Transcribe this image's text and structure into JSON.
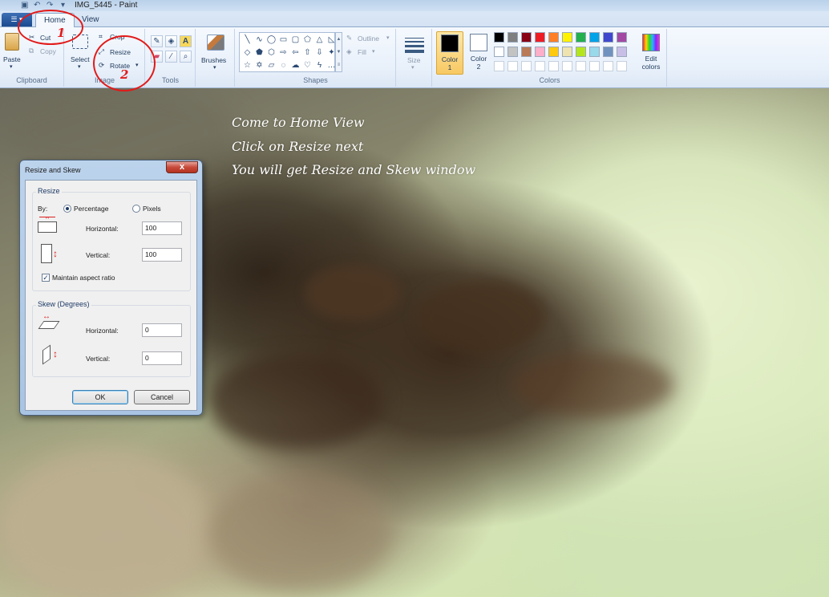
{
  "window": {
    "title": "IMG_5445 - Paint"
  },
  "tabs": [
    {
      "label": "Home"
    },
    {
      "label": "View"
    }
  ],
  "ribbon": {
    "clipboard": {
      "paste": "Paste",
      "cut": "Cut",
      "copy": "Copy",
      "group_label": "Clipboard"
    },
    "image": {
      "select": "Select",
      "crop": "Crop",
      "resize": "Resize",
      "rotate": "Rotate",
      "group_label": "Image"
    },
    "tools": {
      "group_label": "Tools"
    },
    "brushes": {
      "label": "Brushes"
    },
    "shapes": {
      "outline": "Outline",
      "fill": "Fill",
      "group_label": "Shapes"
    },
    "size": {
      "label": "Size"
    },
    "colors": {
      "color1_label": "Color",
      "color1_num": "1",
      "color2_label": "Color",
      "color2_num": "2",
      "edit_colors_line1": "Edit",
      "edit_colors_line2": "colors",
      "group_label": "Colors",
      "color1": "#000000",
      "color2": "#ffffff",
      "palette_row1": [
        "#000000",
        "#7f7f7f",
        "#880015",
        "#ed1c24",
        "#ff7f27",
        "#fff200",
        "#22b14c",
        "#00a2e8",
        "#3f48cc",
        "#a349a4"
      ],
      "palette_row2": [
        "#ffffff",
        "#c3c3c3",
        "#b97a57",
        "#ffaec9",
        "#ffc90e",
        "#efe4b0",
        "#b5e61d",
        "#99d9ea",
        "#7092be",
        "#c8bfe7"
      ]
    }
  },
  "annotations": {
    "mark1": "1",
    "mark2": "2"
  },
  "instructions": [
    "Come to Home View",
    "Click on Resize next",
    "You will get Resize and Skew window"
  ],
  "dialog": {
    "title": "Resize and Skew",
    "close": "x",
    "resize_legend": "Resize",
    "by_label": "By:",
    "percentage_label": "Percentage",
    "pixels_label": "Pixels",
    "horizontal_label": "Horizontal:",
    "vertical_label": "Vertical:",
    "resize_horizontal_value": "100",
    "resize_vertical_value": "100",
    "maintain_aspect_label": "Maintain aspect ratio",
    "skew_legend": "Skew (Degrees)",
    "skew_horizontal_label": "Horizontal:",
    "skew_vertical_label": "Vertical:",
    "skew_horizontal_value": "0",
    "skew_vertical_value": "0",
    "ok": "OK",
    "cancel": "Cancel"
  }
}
